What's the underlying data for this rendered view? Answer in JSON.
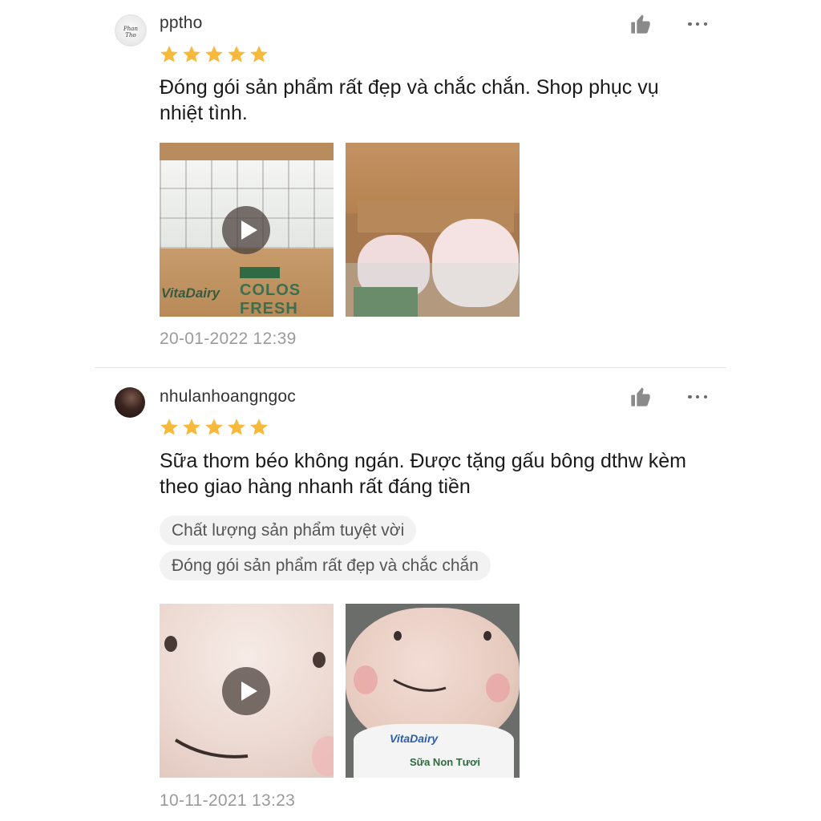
{
  "reviews": [
    {
      "username": "pptho",
      "rating": 5,
      "comment": "Đóng gói sản phẩm rất đẹp và chắc chắn. Shop phục vụ nhiệt tình.",
      "tags": [],
      "timestamp": "20-01-2022 12:39",
      "media": [
        {
          "type": "video",
          "brand_text": "VitaDairy",
          "product_text": "COLOS",
          "product_text2": "FRESH"
        },
        {
          "type": "image"
        }
      ]
    },
    {
      "username": "nhulanhoangngoc",
      "rating": 5,
      "comment": "Sữa thơm béo không ngán. Được tặng gấu bông dthw kèm theo giao hàng nhanh rất đáng tiền",
      "tags": [
        "Chất lượng sản phẩm tuyệt vời",
        "Đóng gói sản phẩm rất đẹp và chắc chắn"
      ],
      "timestamp": "10-11-2021 13:23",
      "media": [
        {
          "type": "video"
        },
        {
          "type": "image",
          "brand_text": "VitaDairy",
          "product_text": "Sữa Non Tươi"
        }
      ]
    }
  ],
  "icons": {
    "star": "star-icon",
    "like": "thumbs-up-icon",
    "more": "more-horizontal-icon",
    "play": "play-icon"
  },
  "colors": {
    "star": "#f6b93b",
    "icon_gray": "#8a8a8a",
    "timestamp": "#9a9a9a",
    "tag_bg": "#f2f2f2"
  }
}
